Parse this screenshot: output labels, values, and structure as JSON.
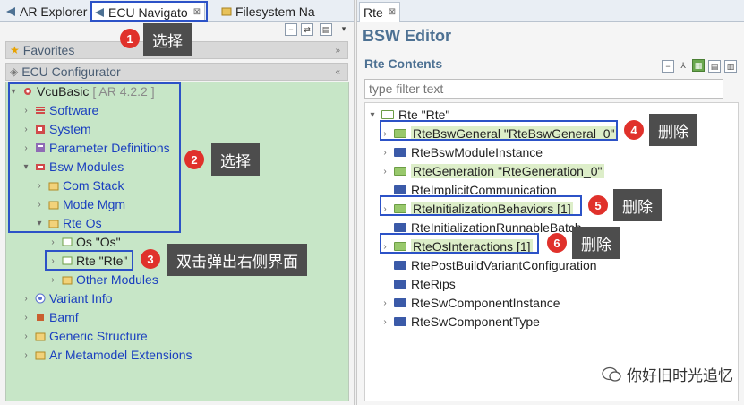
{
  "left": {
    "tabs": [
      {
        "label": "AR Explorer",
        "icon": "explorer-icon"
      },
      {
        "label": "ECU Navigato",
        "icon": "navigator-icon",
        "close": "⊠"
      },
      {
        "label": "Filesystem Na",
        "icon": "filesystem-icon"
      }
    ],
    "favorites_label": "Favorites",
    "ecu_configurator_label": "ECU Configurator",
    "tree": {
      "root_label": "VcuBasic",
      "root_version": "[ AR 4.2.2 ]",
      "software": "Software",
      "system": "System",
      "parameter_definitions": "Parameter Definitions",
      "bsw_modules": "Bsw Modules",
      "com_stack": "Com Stack",
      "mode_mgm": "Mode Mgm",
      "rte_os": "Rte Os",
      "os": "Os \"Os\"",
      "rte": "Rte \"Rte\"",
      "other_modules": "Other Modules",
      "variant_info": "Variant Info",
      "bamf": "Bamf",
      "generic_structure": "Generic Structure",
      "ar_metamodel_extensions": "Ar Metamodel Extensions"
    },
    "annotations": {
      "b1": "1",
      "c1": "选择",
      "b2": "2",
      "c2": "选择",
      "b3": "3",
      "c3": "双击弹出右侧界面"
    }
  },
  "right": {
    "tab_label": "Rte",
    "tab_close": "⊠",
    "editor_title": "BSW Editor",
    "section_title": "Rte Contents",
    "filter_placeholder": "type filter text",
    "tree": {
      "root": "Rte \"Rte\"",
      "items": [
        "RteBswGeneral \"RteBswGeneral_0\"",
        "RteBswModuleInstance",
        "RteGeneration \"RteGeneration_0\"",
        "RteImplicitCommunication",
        "RteInitializationBehaviors [1]",
        "RteInitializationRunnableBatch",
        "RteOsInteractions [1]",
        "RtePostBuildVariantConfiguration",
        "RteRips",
        "RteSwComponentInstance",
        "RteSwComponentType"
      ]
    },
    "annotations": {
      "b4": "4",
      "c4": "删除",
      "b5": "5",
      "c5": "删除",
      "b6": "6",
      "c6": "删除"
    }
  },
  "watermark": "你好旧时光追忆",
  "colors": {
    "tree_bg": "#c7e6c7",
    "annotation_border": "#2c52c7",
    "badge": "#e0312b",
    "callout": "#4d4d4d",
    "editor_title": "#4d7193"
  }
}
